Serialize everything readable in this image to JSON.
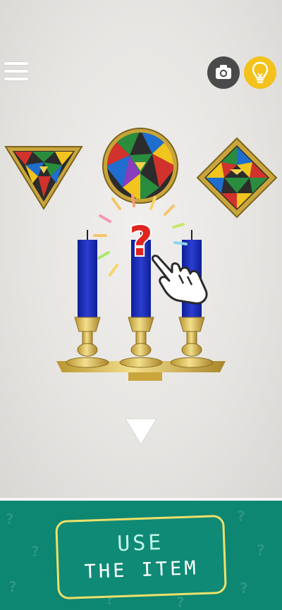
{
  "toolbar": {
    "menu_icon": "hamburger-menu-icon",
    "camera_icon": "camera-icon",
    "hint_icon": "lightbulb-icon",
    "camera_button_color": "#4a4a4a",
    "hint_button_color": "#f3c21b"
  },
  "scene": {
    "wall_color": "#e8e6e3",
    "frames": [
      "triangle",
      "circle",
      "diamond"
    ],
    "candle_count": 3,
    "candle_color": "#1a2fb0",
    "holder_color": "#d9b94c",
    "hint_marker": "?",
    "hint_marker_color": "#e0241f",
    "pointer_icon": "tap-hand-icon",
    "nav_icon": "down-arrow-icon"
  },
  "bottom": {
    "panel_color": "#0d8672",
    "button_line1": "USE",
    "button_line2": "THE ITEM",
    "button_border_color": "#eee06a"
  }
}
